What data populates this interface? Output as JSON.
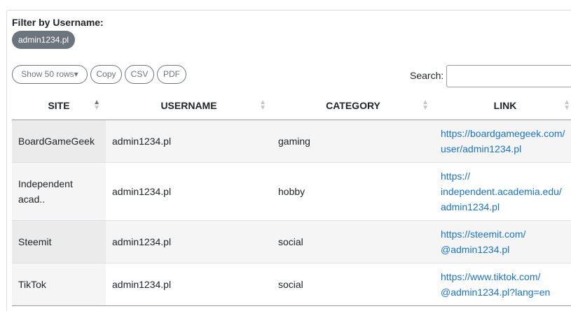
{
  "filter": {
    "label": "Filter by Username:",
    "chip": "admin1234.pl"
  },
  "toolbar": {
    "rows_label": "Show 50 rows▾",
    "copy_label": "Copy",
    "csv_label": "CSV",
    "pdf_label": "PDF"
  },
  "search": {
    "label": "Search:",
    "value": ""
  },
  "table": {
    "columns": [
      "SITE",
      "USERNAME",
      "CATEGORY",
      "LINK"
    ],
    "sorted_column": "SITE",
    "sort_direction": "ascending",
    "rows": [
      {
        "site": "BoardGameGeek",
        "username": "admin1234.pl",
        "category": "gaming",
        "link_lines": [
          "https://boardgamegeek.com/",
          "user/admin1234.pl"
        ]
      },
      {
        "site_lines": [
          "Independent",
          "acad.."
        ],
        "username": "admin1234.pl",
        "category": "hobby",
        "link_lines": [
          "https://",
          "independent.academia.edu/",
          "admin1234.pl"
        ]
      },
      {
        "site": "Steemit",
        "username": "admin1234.pl",
        "category": "social",
        "link_lines": [
          "https://steemit.com/",
          "@admin1234.pl"
        ]
      },
      {
        "site": "TikTok",
        "username": "admin1234.pl",
        "category": "social",
        "link_lines": [
          "https://www.tiktok.com/",
          "@admin1234.pl?lang=en"
        ]
      }
    ]
  },
  "colors": {
    "chip_bg": "#6c757d",
    "link": "#1a73c8",
    "stripe": "#f5f5f5"
  }
}
